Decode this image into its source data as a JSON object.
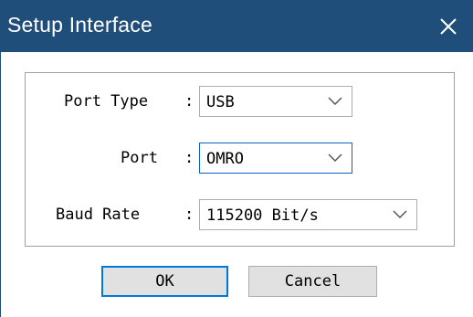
{
  "window": {
    "title": "Setup Interface",
    "close_icon": "close-icon"
  },
  "form": {
    "port_type": {
      "label": "Port Type",
      "separator": ":",
      "value": "USB"
    },
    "port": {
      "label": "Port",
      "separator": ":",
      "value": "OMRO"
    },
    "baud_rate": {
      "label": "Baud Rate",
      "separator": ":",
      "value": "115200 Bit/s"
    }
  },
  "buttons": {
    "ok_label": "OK",
    "cancel_label": "Cancel"
  },
  "colors": {
    "titlebar": "#1f4e7a",
    "focus_border": "#0a64c0",
    "default_button_border": "#0078d7"
  }
}
